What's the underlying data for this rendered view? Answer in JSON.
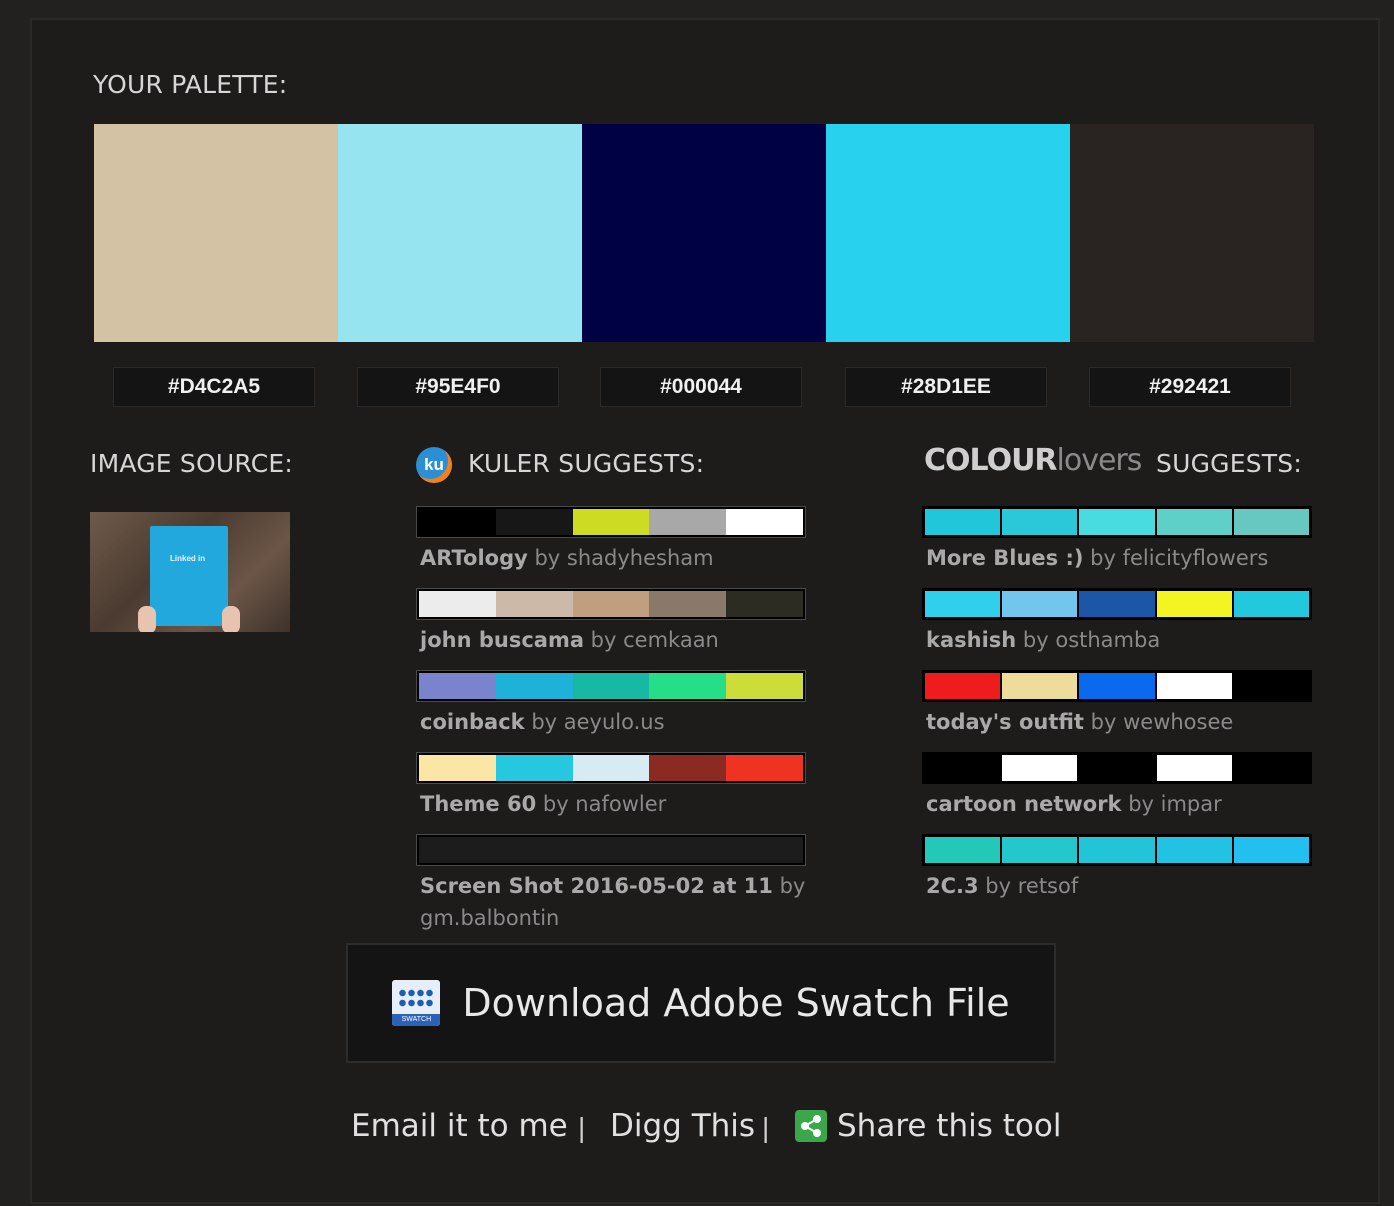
{
  "labels": {
    "your_palette": "YOUR PALETTE:",
    "image_source": "IMAGE SOURCE:",
    "kuler_suggests": "KULER SUGGESTS:",
    "colourlovers_brand_bold": "COLOUR",
    "colourlovers_brand_light": "lovers",
    "colourlovers_suggests": "SUGGESTS:"
  },
  "palette": [
    {
      "hex": "#D4C2A5",
      "color": "#D4C2A5"
    },
    {
      "hex": "#95E4F0",
      "color": "#95E4F0"
    },
    {
      "hex": "#000044",
      "color": "#000044"
    },
    {
      "hex": "#28D1EE",
      "color": "#28D1EE"
    },
    {
      "hex": "#292421",
      "color": "#292421"
    }
  ],
  "kuler": [
    {
      "name": "ARTology",
      "by": "by",
      "author": "shadyhesham",
      "colors": [
        "#000000",
        "#171717",
        "#cddc22",
        "#a8a8a8",
        "#ffffff"
      ]
    },
    {
      "name": "john buscama",
      "by": "by",
      "author": "cemkaan",
      "colors": [
        "#ececec",
        "#cdb9a8",
        "#bf9f80",
        "#8a7868",
        "#2c2c22"
      ]
    },
    {
      "name": "coinback",
      "by": "by",
      "author": "aeyulo.us",
      "colors": [
        "#7a84cc",
        "#1fb2d8",
        "#17b8a4",
        "#26de88",
        "#ccdc38"
      ]
    },
    {
      "name": "Theme 60",
      "by": "by",
      "author": "nafowler",
      "colors": [
        "#fbe6a6",
        "#26c8df",
        "#d6ecf2",
        "#8a2a22",
        "#ee3322"
      ]
    },
    {
      "name": "Screen Shot 2016-05-02 at 11",
      "by": "by",
      "author": "gm.balbontin",
      "colors": [
        "#1c1c1c",
        "#1c1c1c",
        "#1c1c1c",
        "#1c1c1c",
        "#1c1c1c"
      ]
    }
  ],
  "colourlovers": [
    {
      "name": "More Blues :)",
      "by": "by",
      "author": "felicityflowers",
      "colors": [
        "#22c6da",
        "#2ac8d8",
        "#48dce0",
        "#5ed0c8",
        "#66c8c0"
      ]
    },
    {
      "name": "kashish",
      "by": "by",
      "author": "osthamba",
      "colors": [
        "#30d0ec",
        "#72c6ee",
        "#1c56a6",
        "#f4f422",
        "#22c8dc"
      ]
    },
    {
      "name": "today's outfit",
      "by": "by",
      "author": "wewhosee",
      "colors": [
        "#ee1c1c",
        "#eedc9a",
        "#0a6aee",
        "#ffffff",
        "#000000"
      ]
    },
    {
      "name": "cartoon network",
      "by": "by",
      "author": "impar",
      "colors": [
        "#000000",
        "#ffffff",
        "#000000",
        "#ffffff",
        "#000000"
      ]
    },
    {
      "name": "2C.3",
      "by": "by",
      "author": "retsof",
      "colors": [
        "#22c8b8",
        "#22c8cc",
        "#22c4d8",
        "#22c2e2",
        "#22c0ee"
      ]
    }
  ],
  "thumbnail": {
    "text": "Linked in"
  },
  "swatch_icon_label": "SWATCH",
  "download": {
    "label": "Download Adobe Swatch File"
  },
  "footer": {
    "email": "Email it to me",
    "digg": "Digg This",
    "share": "Share this tool",
    "separator": "|"
  }
}
